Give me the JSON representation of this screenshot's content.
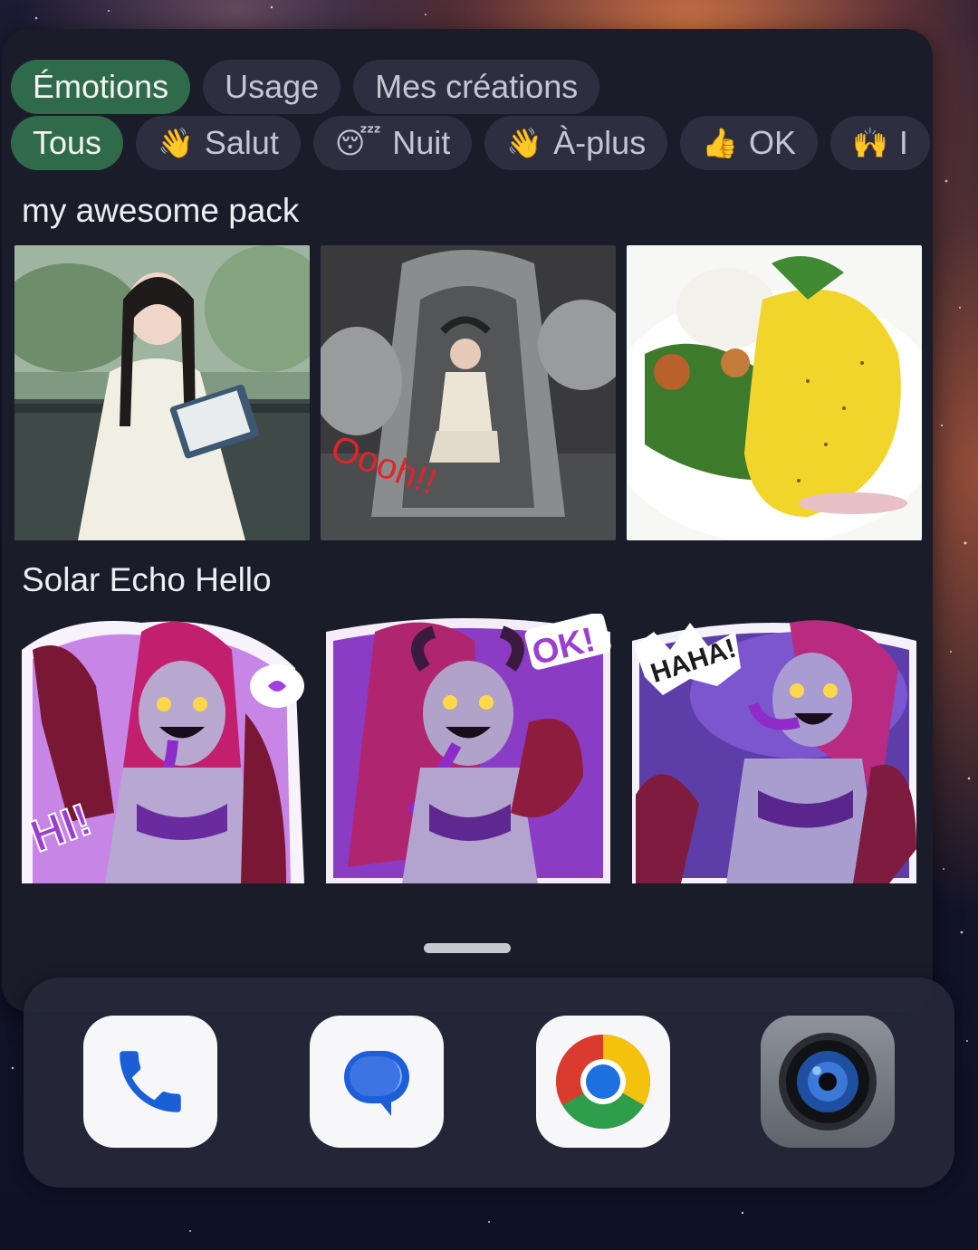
{
  "emotion_tabs": [
    {
      "label": "Émotions",
      "active": true
    },
    {
      "label": "Usage",
      "active": false
    },
    {
      "label": "Mes créations",
      "active": false
    }
  ],
  "filter_chips": [
    {
      "label": "Tous",
      "emoji": "",
      "active": true
    },
    {
      "label": "Salut",
      "emoji": "👋",
      "active": false
    },
    {
      "label": "Nuit",
      "emoji": "😴",
      "active": false
    },
    {
      "label": "À-plus",
      "emoji": "👋",
      "active": false
    },
    {
      "label": "OK",
      "emoji": "👍",
      "active": false
    },
    {
      "label": "I",
      "emoji": "🙌",
      "active": false
    }
  ],
  "packs": [
    {
      "title": "my awesome pack",
      "stickers": [
        {
          "icon": "woman-reading-book-sticker"
        },
        {
          "icon": "oooh-stone-dragon-sticker",
          "caption": "Oooh!!"
        },
        {
          "icon": "omelette-salad-sticker"
        }
      ]
    },
    {
      "title": "Solar Echo Hello",
      "stickers": [
        {
          "icon": "demon-girl-hi-sticker",
          "caption": "HI!"
        },
        {
          "icon": "demon-girl-ok-sticker",
          "caption": "OK!"
        },
        {
          "icon": "demon-girl-haha-sticker",
          "caption": "HAHA!"
        }
      ]
    }
  ],
  "dock": [
    {
      "name": "phone",
      "icon": "phone-icon"
    },
    {
      "name": "messages",
      "icon": "messages-icon"
    },
    {
      "name": "chrome",
      "icon": "chrome-icon"
    },
    {
      "name": "camera",
      "icon": "camera-icon"
    }
  ],
  "colors": {
    "panel": "#1b1c2a",
    "chip": "#2d2f40",
    "chip_active": "#2f6a4b",
    "accent_purple": "#9b3fd1"
  }
}
